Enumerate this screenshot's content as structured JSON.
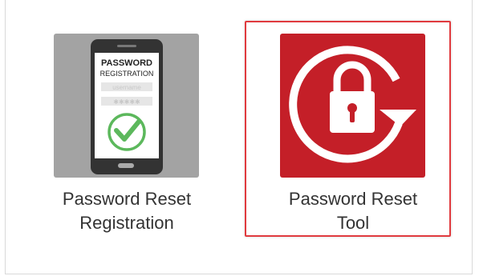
{
  "apps": [
    {
      "label_line1": "Password Reset",
      "label_line2": "Registration",
      "icon": "phone-password-registration-icon",
      "tile_color": "#a3a3a3",
      "phone_text": {
        "title": "PASSWORD",
        "subtitle": "REGISTRATION",
        "username": "username",
        "password_mask": "✱✱✱✱✱"
      }
    },
    {
      "label_line1": "Password Reset",
      "label_line2": "Tool",
      "icon": "padlock-refresh-icon",
      "tile_color": "#c41f28",
      "selected": true
    }
  ],
  "colors": {
    "highlight_border": "#e03a3e",
    "check_green": "#5cb85c",
    "label_text": "#333333"
  }
}
